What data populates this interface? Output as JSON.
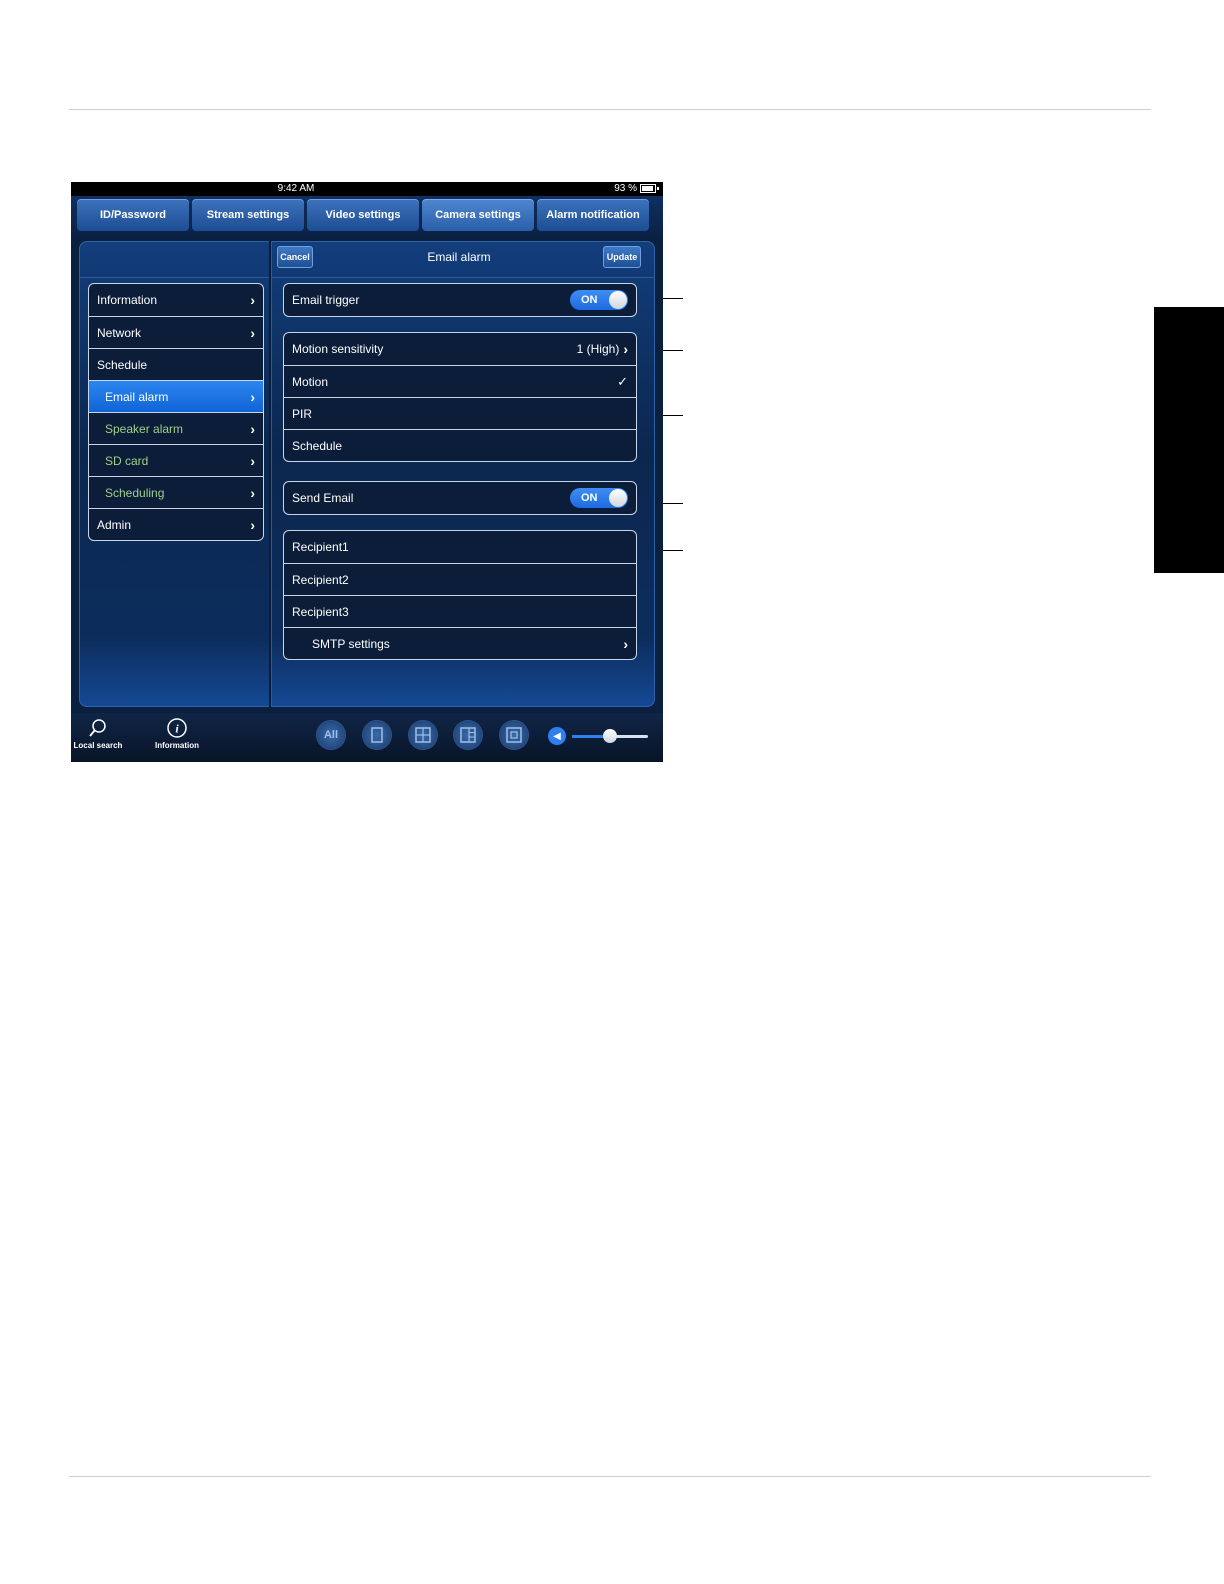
{
  "status_bar": {
    "time": "9:42 AM",
    "battery": "93 %"
  },
  "tabs": [
    {
      "label": "ID/Password"
    },
    {
      "label": "Stream settings"
    },
    {
      "label": "Video settings"
    },
    {
      "label": "Camera settings",
      "active": true
    },
    {
      "label": "Alarm notification"
    }
  ],
  "header": {
    "cancel": "Cancel",
    "title": "Email alarm",
    "update": "Update"
  },
  "sidebar": {
    "items": [
      {
        "label": "Information"
      },
      {
        "label": "Network"
      },
      {
        "label": "Schedule"
      },
      {
        "label": "Email alarm",
        "selected": true
      },
      {
        "label": "Speaker alarm"
      },
      {
        "label": "SD card"
      },
      {
        "label": "Scheduling"
      },
      {
        "label": "Admin"
      }
    ]
  },
  "email_trigger": {
    "label": "Email trigger",
    "toggle": "ON"
  },
  "motion": {
    "sensitivity_label": "Motion sensitivity",
    "sensitivity_value": "1 (High)",
    "rows": [
      "Motion",
      "PIR",
      "Schedule"
    ],
    "checkmark": "✓"
  },
  "send_email": {
    "label": "Send Email",
    "toggle": "ON"
  },
  "recipients": {
    "rows": [
      "Recipient1",
      "Recipient2",
      "Recipient3"
    ],
    "smtp": "SMTP settings"
  },
  "bottom_bar": {
    "local_search": "Local search",
    "information": "Information",
    "all_button": "All",
    "volume_level": 0.5
  },
  "colors": {
    "accent": "#1d6ae0",
    "selected_row": "#1163d6",
    "green_text": "#9ed18a"
  }
}
